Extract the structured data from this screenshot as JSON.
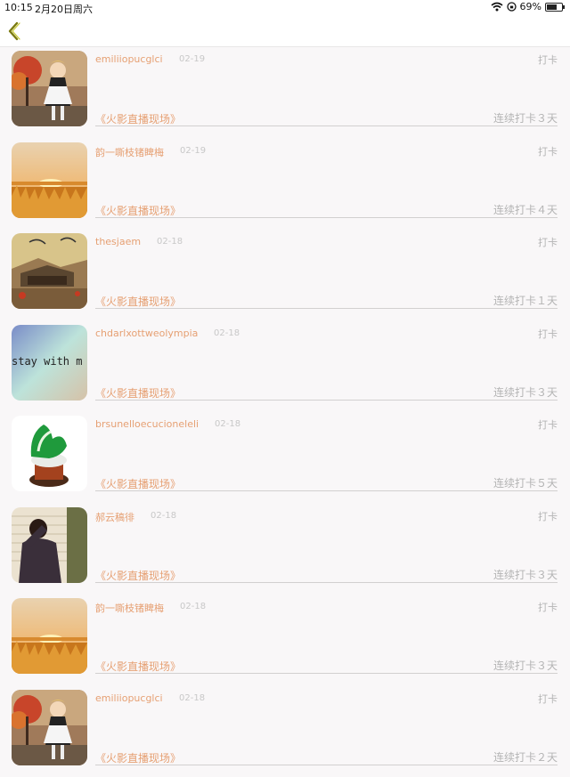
{
  "status_bar": {
    "time": "10:15",
    "date": "2月20日周六",
    "battery_text": "69%",
    "battery_level": 0.69
  },
  "nav": {
    "back_icon": "chevron-left-icon",
    "accent": "#9a9a22"
  },
  "colors": {
    "name": "#e6a073",
    "muted": "#b4b4b4",
    "date": "#c8c8c8"
  },
  "rows": [
    {
      "name": "emiliiopucglci",
      "date": "02-19",
      "action": "打卡",
      "topic": "《火影直播现场》",
      "streak": "连续打卡３天",
      "avatar": "anime-girl-autumn"
    },
    {
      "name": "韵一嘶枝锗睥梅",
      "date": "02-19",
      "action": "打卡",
      "topic": "《火影直播现场》",
      "streak": "连续打卡４天",
      "avatar": "sunset-wheat-field"
    },
    {
      "name": "thesjaem",
      "date": "02-18",
      "action": "打卡",
      "topic": "《火影直播现场》",
      "streak": "连续打卡１天",
      "avatar": "ancient-town-painting"
    },
    {
      "name": "chdarlxottweolympia",
      "date": "02-18",
      "action": "打卡",
      "topic": "《火影直播现场》",
      "streak": "连续打卡３天",
      "avatar": "stay-with-me-text",
      "avatar_text": "stay with m"
    },
    {
      "name": "brsunelloecucioneleli",
      "date": "02-18",
      "action": "打卡",
      "topic": "《火影直播现场》",
      "streak": "连续打卡５天",
      "avatar": "jade-cabbage"
    },
    {
      "name": "郝云稿徘",
      "date": "02-18",
      "action": "打卡",
      "topic": "《火影直播现场》",
      "streak": "连续打卡３天",
      "avatar": "man-by-wall"
    },
    {
      "name": "韵一嘶枝锗睥梅",
      "date": "02-18",
      "action": "打卡",
      "topic": "《火影直播现场》",
      "streak": "连续打卡３天",
      "avatar": "sunset-wheat-field"
    },
    {
      "name": "emiliiopucglci",
      "date": "02-18",
      "action": "打卡",
      "topic": "《火影直播现场》",
      "streak": "连续打卡２天",
      "avatar": "anime-girl-autumn"
    }
  ]
}
